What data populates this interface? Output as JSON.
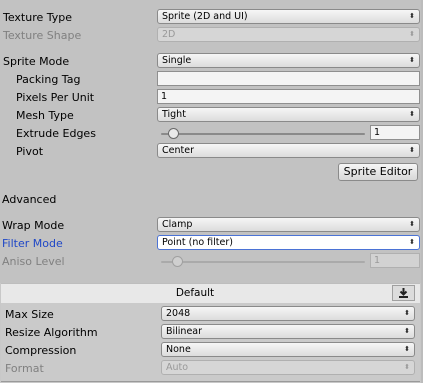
{
  "texture_type": {
    "label": "Texture Type",
    "value": "Sprite (2D and UI)"
  },
  "texture_shape": {
    "label": "Texture Shape",
    "value": "2D"
  },
  "sprite_mode": {
    "label": "Sprite Mode",
    "value": "Single"
  },
  "packing_tag": {
    "label": "Packing Tag",
    "value": ""
  },
  "pixels_per_unit": {
    "label": "Pixels Per Unit",
    "value": "1"
  },
  "mesh_type": {
    "label": "Mesh Type",
    "value": "Tight"
  },
  "extrude_edges": {
    "label": "Extrude Edges",
    "value": "1",
    "slider_fraction": 0.06
  },
  "pivot": {
    "label": "Pivot",
    "value": "Center"
  },
  "sprite_editor_button": "Sprite Editor",
  "advanced_label": "Advanced",
  "wrap_mode": {
    "label": "Wrap Mode",
    "value": "Clamp"
  },
  "filter_mode": {
    "label": "Filter Mode",
    "value": "Point (no filter)"
  },
  "aniso_level": {
    "label": "Aniso Level",
    "value": "1",
    "slider_fraction": 0.08
  },
  "platform": {
    "tab_label": "Default",
    "max_size": {
      "label": "Max Size",
      "value": "2048"
    },
    "resize_algorithm": {
      "label": "Resize Algorithm",
      "value": "Bilinear"
    },
    "compression": {
      "label": "Compression",
      "value": "None"
    },
    "format": {
      "label": "Format",
      "value": "Auto"
    }
  },
  "icons": {
    "dropdown": "updown-arrow-icon",
    "download": "download-icon"
  },
  "colors": {
    "highlight_label": "#1f47c7",
    "selected_border": "#4b73d6"
  }
}
